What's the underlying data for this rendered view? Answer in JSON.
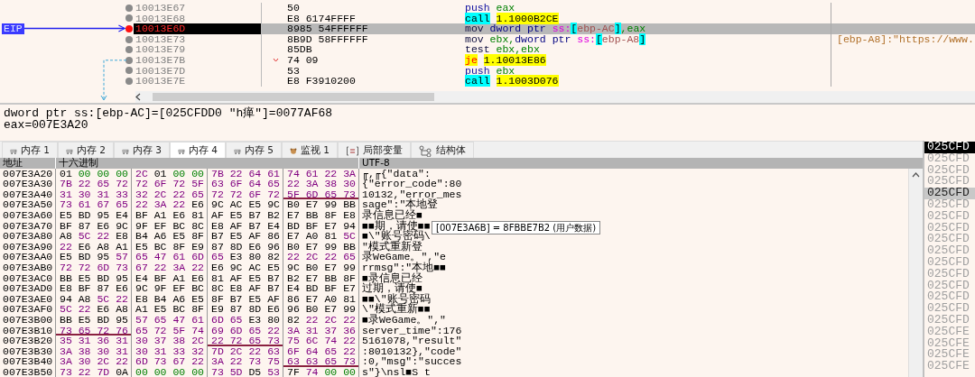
{
  "disassembly": {
    "rows": [
      {
        "address": "10013E67",
        "bytes": "50",
        "eip": false,
        "jump_down": false,
        "instruction": [
          {
            "t": "push",
            "kind": "push"
          },
          {
            "t": "eax",
            "kind": "reg"
          }
        ]
      },
      {
        "address": "10013E68",
        "bytes": "E8 6174FFFF",
        "eip": false,
        "jump_down": false,
        "instruction": [
          {
            "t": "call",
            "kind": "call"
          },
          {
            "t": "1.1000B2CE",
            "kind": "target"
          }
        ]
      },
      {
        "address": "10013E6D",
        "bytes": "8985 54FFFFFF",
        "eip": true,
        "eip_label": "EIP",
        "jump_down": false,
        "instruction": [
          {
            "t": "mov",
            "kind": "mov"
          },
          {
            "t": "dword ptr",
            "kind": "size"
          },
          {
            "t": "ss:",
            "kind": "seg"
          },
          {
            "t": "[",
            "kind": "bracket"
          },
          {
            "t": "ebp-AC",
            "kind": "mem"
          },
          {
            "t": "]",
            "kind": "bracket"
          },
          {
            "t": ",eax",
            "kind": "reg"
          }
        ]
      },
      {
        "address": "10013E73",
        "bytes": "8B9D 58FFFFFF",
        "eip": false,
        "jump_down": false,
        "instruction": [
          {
            "t": "mov",
            "kind": "mov"
          },
          {
            "t": "ebx,",
            "kind": "reg"
          },
          {
            "t": "dword ptr",
            "kind": "size"
          },
          {
            "t": "ss:",
            "kind": "seg"
          },
          {
            "t": "[",
            "kind": "bracket"
          },
          {
            "t": "ebp-A8",
            "kind": "mem"
          },
          {
            "t": "]",
            "kind": "bracket"
          }
        ],
        "comment": "[ebp-A8]:\"https://www."
      },
      {
        "address": "10013E79",
        "bytes": "85DB",
        "eip": false,
        "jump_down": false,
        "instruction": [
          {
            "t": "test",
            "kind": "test"
          },
          {
            "t": "ebx,ebx",
            "kind": "reg"
          }
        ]
      },
      {
        "address": "10013E7B",
        "bytes": "74 09",
        "eip": false,
        "jump_down": true,
        "instruction": [
          {
            "t": "je",
            "kind": "je"
          },
          {
            "t": "1.10013E86",
            "kind": "target"
          }
        ]
      },
      {
        "address": "10013E7D",
        "bytes": "53",
        "eip": false,
        "jump_down": false,
        "instruction": [
          {
            "t": "push",
            "kind": "push"
          },
          {
            "t": "ebx",
            "kind": "reg"
          }
        ]
      },
      {
        "address": "10013E7E",
        "bytes": "E8 F3910200",
        "eip": false,
        "jump_down": false,
        "instruction": [
          {
            "t": "call",
            "kind": "call"
          },
          {
            "t": "1.1003D076",
            "kind": "target"
          }
        ]
      }
    ]
  },
  "info": [
    "dword ptr ss:[ebp-AC]=[025CFDD0 \"h瘅\"]=0077AF68",
    "eax=007E3A20"
  ],
  "tabs": [
    {
      "label": "内存 1",
      "kind": "memory",
      "selected": false
    },
    {
      "label": "内存 2",
      "kind": "memory",
      "selected": false
    },
    {
      "label": "内存 3",
      "kind": "memory",
      "selected": false
    },
    {
      "label": "内存 4",
      "kind": "memory",
      "selected": true
    },
    {
      "label": "内存 5",
      "kind": "memory",
      "selected": false
    },
    {
      "label": "监视 1",
      "kind": "watch",
      "selected": false
    },
    {
      "label": "局部变量",
      "kind": "locals",
      "selected": false
    },
    {
      "label": "结构体",
      "kind": "struct",
      "selected": false
    }
  ],
  "dump": {
    "columns": [
      "地址",
      "十六进制",
      "UTF-8"
    ],
    "rows": [
      {
        "address": "007E3A20",
        "hex": "01 00 00 00 2C 01 00 00 7B 22 64 61 74 61 22 3A",
        "text": "╓,╓{\"data\":",
        "underline": [
          false,
          false,
          false,
          false
        ]
      },
      {
        "address": "007E3A30",
        "hex": "7B 22 65 72 72 6F 72 5F 63 6F 64 65 22 3A 38 30",
        "text": "{\"error_code\":80",
        "underline": [
          false,
          false,
          false,
          false
        ]
      },
      {
        "address": "007E3A40",
        "hex": "31 30 31 33 32 2C 22 65 72 72 6F 72 5F 6D 65 73",
        "text": "10132,\"error_mes",
        "underline": [
          false,
          false,
          false,
          true
        ]
      },
      {
        "address": "007E3A50",
        "hex": "73 61 67 65 22 3A 22 E6 9C AC E5 9C B0 E7 99 BB",
        "text": "sage\":\"本地登",
        "underline": [
          false,
          false,
          false,
          false
        ]
      },
      {
        "address": "007E3A60",
        "hex": "E5 BD 95 E4 BF A1 E6 81 AF E5 B7 B2 E7 BB 8F E8",
        "text": "录信息已经■",
        "underline": [
          false,
          false,
          false,
          false
        ]
      },
      {
        "address": "007E3A70",
        "hex": "BF 87 E6 9C 9F EF BC 8C E8 AF B7 E4 BD BF E7 94",
        "text": "■■期，请使■■",
        "underline": [
          false,
          false,
          false,
          false
        ]
      },
      {
        "address": "007E3A80",
        "hex": "A8 5C 22 E8 B4 A6 E5 8F B7 E5 AF 86 E7 A0 81 5C",
        "text": "■\\\"账号密码\\",
        "underline": [
          false,
          false,
          false,
          false
        ]
      },
      {
        "address": "007E3A90",
        "hex": "22 E6 A8 A1 E5 BC 8F E9 87 8D E6 96 B0 E7 99 BB",
        "text": "\"模式重新登",
        "underline": [
          false,
          false,
          false,
          false
        ]
      },
      {
        "address": "007E3AA0",
        "hex": "E5 BD 95 57 65 47 61 6D 65 E3 80 82 22 2C 22 65",
        "text": "录WeGame。\",\"e",
        "underline": [
          false,
          false,
          false,
          false
        ]
      },
      {
        "address": "007E3AB0",
        "hex": "72 72 6D 73 67 22 3A 22 E6 9C AC E5 9C B0 E7 99",
        "text": "rrmsg\":\"本地■■",
        "underline": [
          false,
          false,
          false,
          false
        ]
      },
      {
        "address": "007E3AC0",
        "hex": "BB E5 BD 95 E4 BF A1 E6 81 AF E5 B7 B2 E7 BB 8F",
        "text": "■录信息已经",
        "underline": [
          false,
          false,
          false,
          false
        ]
      },
      {
        "address": "007E3AD0",
        "hex": "E8 BF 87 E6 9C 9F EF BC 8C E8 AF B7 E4 BD BF E7",
        "text": "过期，请使■",
        "underline": [
          false,
          false,
          false,
          false
        ]
      },
      {
        "address": "007E3AE0",
        "hex": "94 A8 5C 22 E8 B4 A6 E5 8F B7 E5 AF 86 E7 A0 81",
        "text": "■■\\\"账号密码",
        "underline": [
          false,
          false,
          false,
          false
        ]
      },
      {
        "address": "007E3AF0",
        "hex": "5C 22 E6 A8 A1 E5 BC 8F E9 87 8D E6 96 B0 E7 99",
        "text": "\\\"模式重新■■",
        "underline": [
          false,
          false,
          false,
          false
        ]
      },
      {
        "address": "007E3B00",
        "hex": "BB E5 BD 95 57 65 47 61 6D 65 E3 80 82 22 2C 22",
        "text": "■录WeGame。\",\"",
        "underline": [
          false,
          false,
          false,
          false
        ]
      },
      {
        "address": "007E3B10",
        "hex": "73 65 72 76 65 72 5F 74 69 6D 65 22 3A 31 37 36",
        "text": "server_time\":176",
        "underline": [
          true,
          false,
          false,
          false
        ]
      },
      {
        "address": "007E3B20",
        "hex": "35 31 36 31 30 37 38 2C 22 72 65 73 75 6C 74 22",
        "text": "5161078,\"result\"",
        "underline": [
          false,
          false,
          true,
          false
        ]
      },
      {
        "address": "007E3B30",
        "hex": "3A 38 30 31 30 31 33 32 7D 2C 22 63 6F 64 65 22",
        "text": ":8010132},\"code\"",
        "underline": [
          false,
          false,
          false,
          false
        ]
      },
      {
        "address": "007E3B40",
        "hex": "3A 30 2C 22 6D 73 67 22 3A 22 73 75 63 63 65 73",
        "text": ":0,\"msg\":\"succes",
        "underline": [
          false,
          false,
          false,
          true
        ]
      },
      {
        "address": "007E3B50",
        "hex": "73 22 7D 0A 00 00 00 00 73 5D D5 53 7F 74 00 00",
        "text": "s\"}\\nsl■S t",
        "underline": [
          false,
          false,
          false,
          false
        ]
      }
    ]
  },
  "tooltip": "[007E3A6B] = 8FBBE7B2 (用户数据)",
  "stack": [
    {
      "text": "025CFD",
      "selected": true,
      "highlighted": false
    },
    {
      "text": "025CFD",
      "selected": false,
      "highlighted": false
    },
    {
      "text": "025CFD",
      "selected": false,
      "highlighted": false
    },
    {
      "text": "025CFD",
      "selected": false,
      "highlighted": false
    },
    {
      "text": "025CFD",
      "selected": false,
      "highlighted": true
    },
    {
      "text": "025CFD",
      "selected": false,
      "highlighted": false
    },
    {
      "text": "025CFD",
      "selected": false,
      "highlighted": false
    },
    {
      "text": "025CFD",
      "selected": false,
      "highlighted": false
    },
    {
      "text": "025CFD",
      "selected": false,
      "highlighted": false
    },
    {
      "text": "025CFD",
      "selected": false,
      "highlighted": false
    },
    {
      "text": "025CFD",
      "selected": false,
      "highlighted": false
    },
    {
      "text": "025CFD",
      "selected": false,
      "highlighted": false
    },
    {
      "text": "025CFD",
      "selected": false,
      "highlighted": false
    },
    {
      "text": "025CFD",
      "selected": false,
      "highlighted": false
    },
    {
      "text": "025CFD",
      "selected": false,
      "highlighted": false
    },
    {
      "text": "025CFD",
      "selected": false,
      "highlighted": false
    },
    {
      "text": "025CFE",
      "selected": false,
      "highlighted": false
    },
    {
      "text": "025CFE",
      "selected": false,
      "highlighted": false
    },
    {
      "text": "025CFE",
      "selected": false,
      "highlighted": false
    },
    {
      "text": "025CFE",
      "selected": false,
      "highlighted": false
    }
  ]
}
